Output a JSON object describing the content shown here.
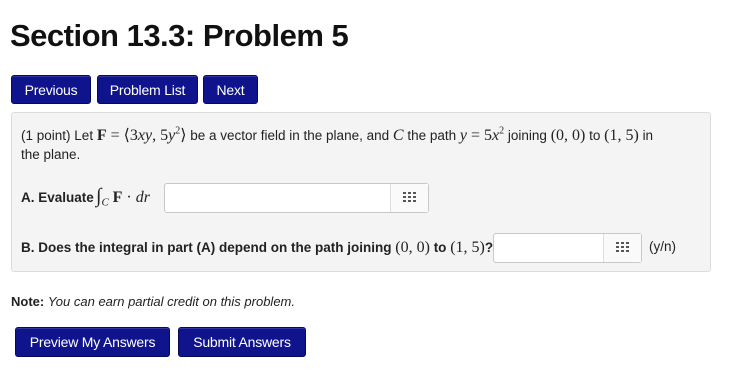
{
  "page": {
    "title": "Section 13.3: Problem 5"
  },
  "nav": {
    "previous": "Previous",
    "problem_list": "Problem List",
    "next": "Next"
  },
  "problem": {
    "points": "(1 point)",
    "statement_prefix": "Let",
    "field_expr": "F = ⟨3xy, 5y²⟩",
    "statement_mid": "be a vector field in the plane, and",
    "path_symbol": "C",
    "statement_path": "the path",
    "path_expr": "y = 5x²",
    "joining": "joining",
    "start_point": "(0, 0)",
    "to": "to",
    "end_point": "(1, 5)",
    "statement_end": "in",
    "statement_line2": "the plane.",
    "part_a": {
      "label": "A. Evaluate",
      "integral_expr": "∫",
      "integral_sub": "C",
      "integral_body": "F · dr",
      "value": ""
    },
    "part_b": {
      "label": "B. Does the integral in part (A) depend on the path joining",
      "start_point": "(0, 0)",
      "to": "to",
      "end_point": "(1, 5)",
      "qmark": "?",
      "value": "",
      "hint": "(y/n)"
    }
  },
  "note": {
    "label": "Note:",
    "text": "You can earn partial credit on this problem."
  },
  "actions": {
    "preview": "Preview My Answers",
    "submit": "Submit Answers"
  },
  "colors": {
    "button_bg": "#10148c",
    "panel_bg": "#f4f4f4"
  },
  "icons": {
    "equation_editor": "grid-icon"
  }
}
